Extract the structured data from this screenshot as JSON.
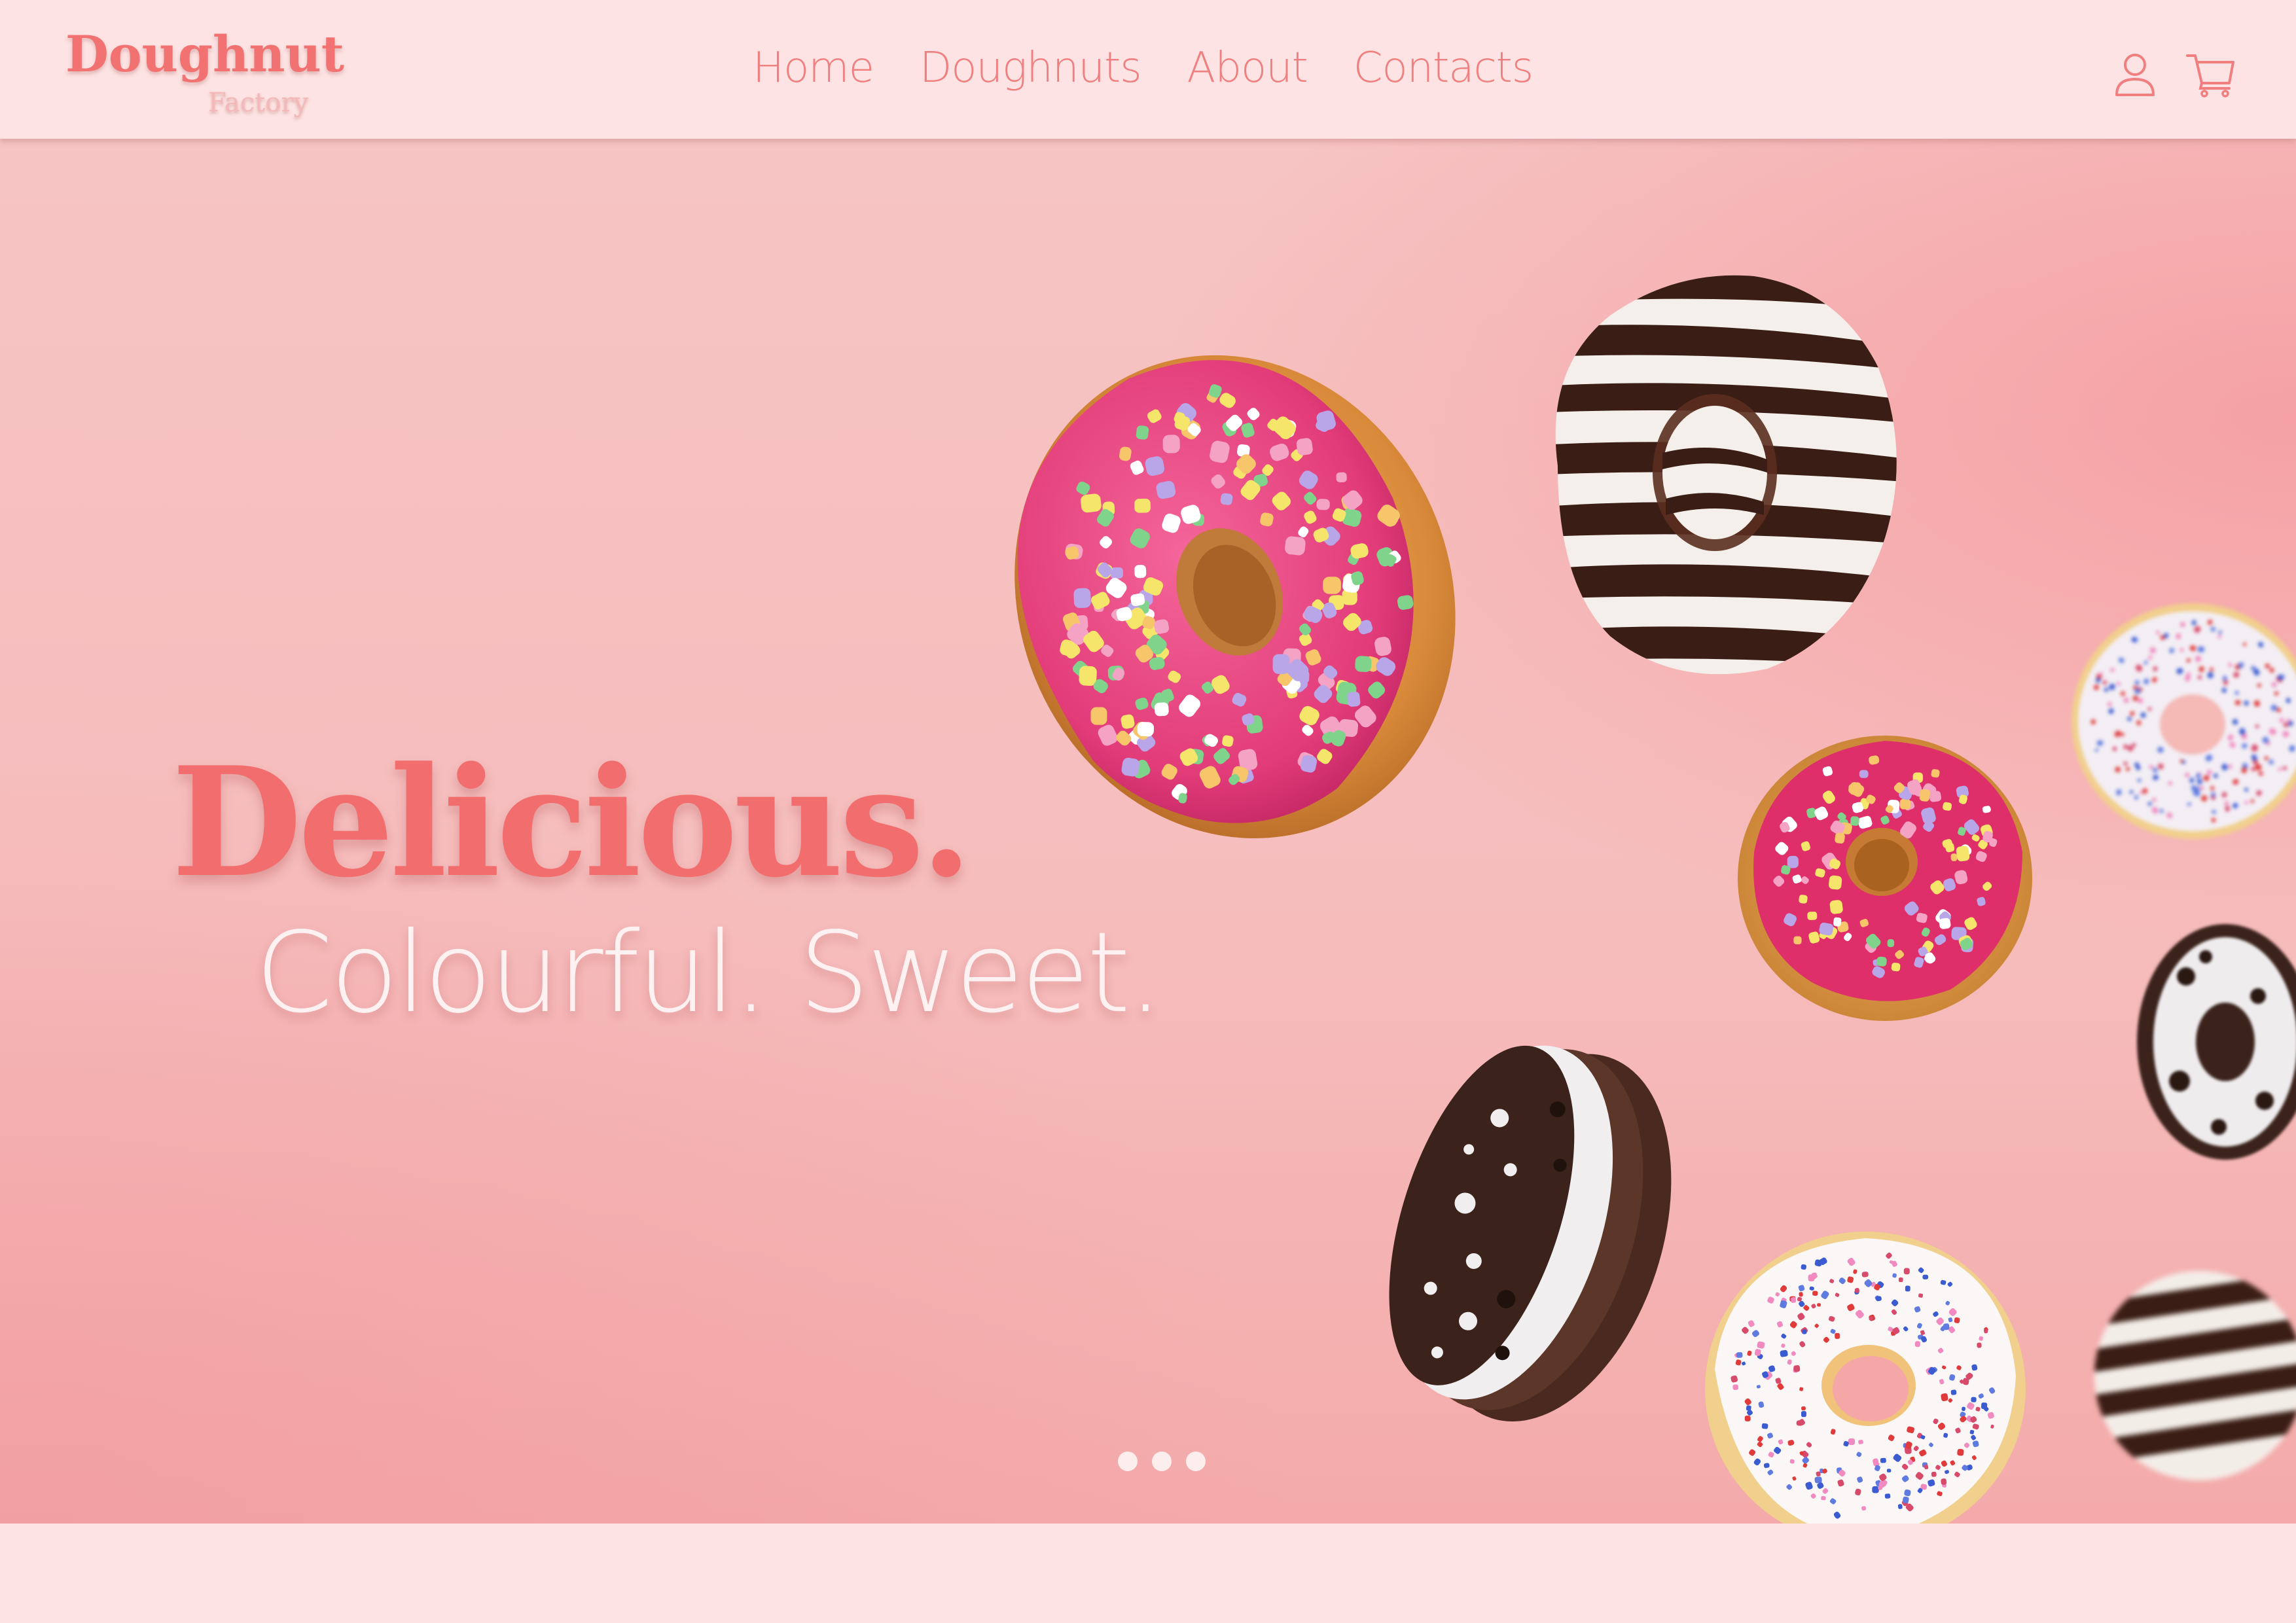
{
  "brand": {
    "name": "Doughnut",
    "tagline": "Factory"
  },
  "nav": {
    "items": [
      {
        "label": "Home"
      },
      {
        "label": "Doughnuts"
      },
      {
        "label": "About"
      },
      {
        "label": "Contacts"
      }
    ]
  },
  "header_icons": {
    "account": "user-icon",
    "cart": "cart-icon"
  },
  "hero": {
    "headline": "Delicious.",
    "subheadline": "Colourful. Sweet.",
    "carousel": {
      "slide_count": 3
    },
    "images": [
      "pink-sprinkle-doughnut",
      "zebra-striped-doughnut",
      "pink-sprinkle-doughnut-small",
      "cookies-and-cream-doughnut",
      "white-sprinkle-doughnut",
      "blurred-sprinkle-doughnut",
      "blurred-cookies-doughnut",
      "blurred-zebra-doughnut"
    ]
  },
  "colors": {
    "brand": "#f27272",
    "nav_text": "#f08080",
    "header_bg": "#fde3e3",
    "hero_bg": "#f6c0c0",
    "subheadline": "#fdf1f1"
  }
}
